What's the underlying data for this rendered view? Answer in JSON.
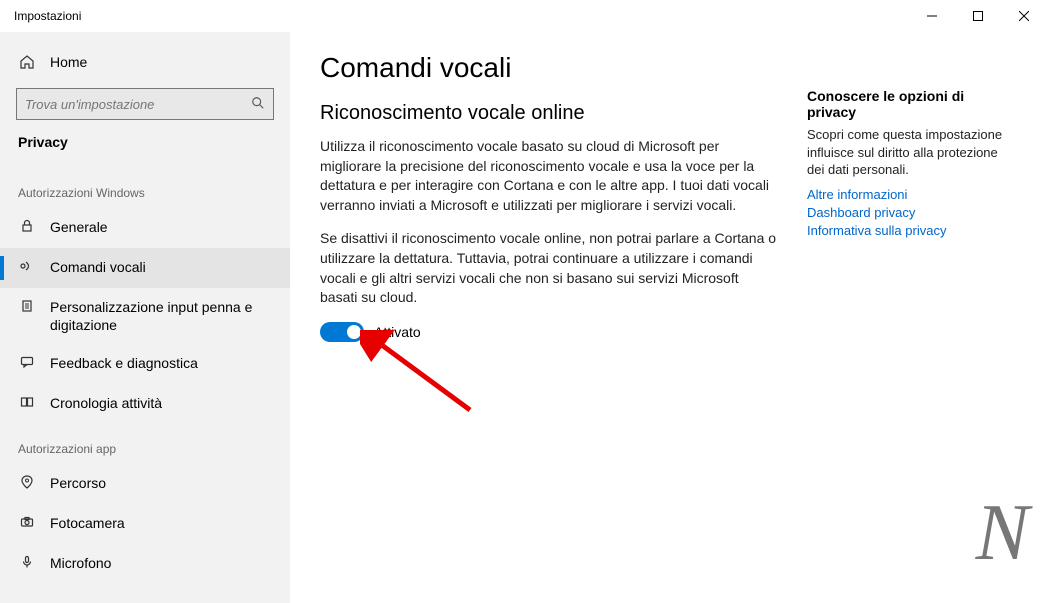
{
  "window": {
    "title": "Impostazioni"
  },
  "sidebar": {
    "home": "Home",
    "search_placeholder": "Trova un'impostazione",
    "breadcrumb": "Privacy",
    "section1": "Autorizzazioni Windows",
    "items1": [
      {
        "label": "Generale"
      },
      {
        "label": "Comandi vocali"
      },
      {
        "label": "Personalizzazione input penna e digitazione"
      },
      {
        "label": "Feedback e diagnostica"
      },
      {
        "label": "Cronologia attività"
      }
    ],
    "section2": "Autorizzazioni app",
    "items2": [
      {
        "label": "Percorso"
      },
      {
        "label": "Fotocamera"
      },
      {
        "label": "Microfono"
      }
    ]
  },
  "main": {
    "title": "Comandi vocali",
    "section_title": "Riconoscimento vocale online",
    "para1": "Utilizza il riconoscimento vocale basato su cloud di Microsoft per migliorare la precisione del riconoscimento vocale e usa la voce per la dettatura e per interagire con Cortana e con le altre app. I tuoi dati vocali verranno inviati a Microsoft e utilizzati per migliorare i servizi vocali.",
    "para2": "Se disattivi il riconoscimento vocale online, non potrai parlare a Cortana o utilizzare la dettatura. Tuttavia, potrai continuare a utilizzare i comandi vocali e gli altri servizi vocali che non si basano sui servizi Microsoft basati su cloud.",
    "toggle_label": "Attivato"
  },
  "aside": {
    "title": "Conoscere le opzioni di privacy",
    "desc": "Scopri come questa impostazione influisce sul diritto alla protezione dei dati personali.",
    "links": [
      "Altre informazioni",
      "Dashboard privacy",
      "Informativa sulla privacy"
    ]
  },
  "watermark": "N"
}
